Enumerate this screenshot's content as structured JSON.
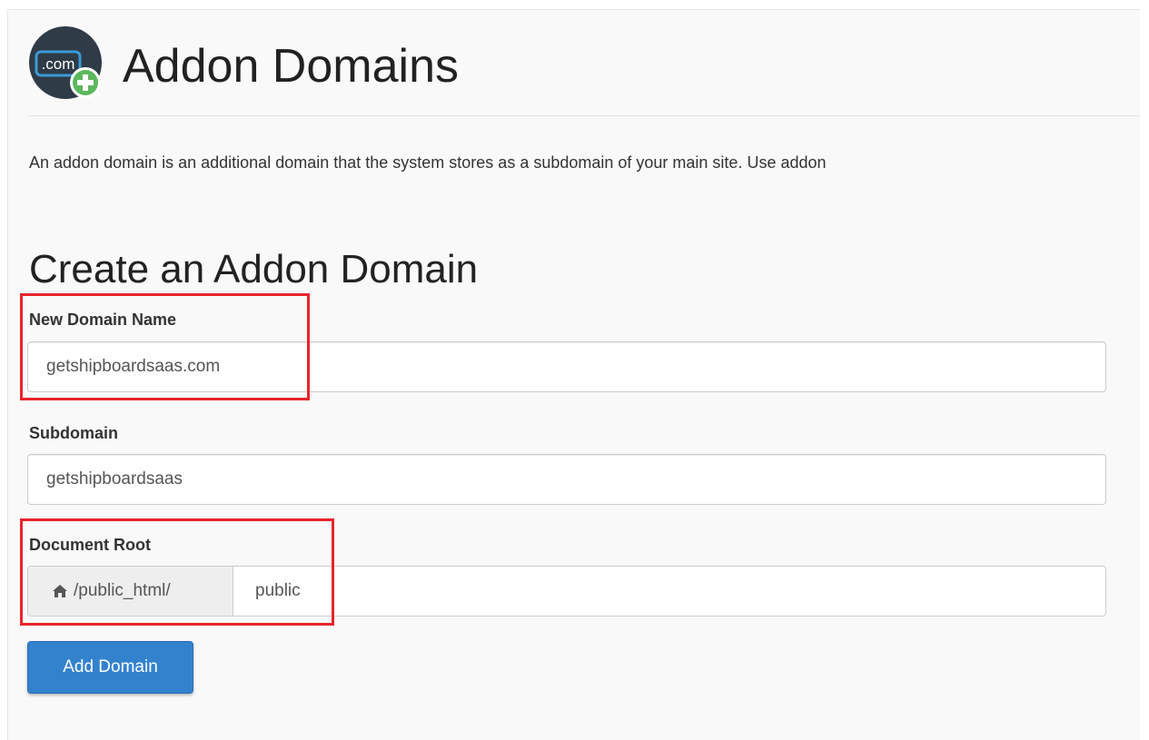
{
  "header": {
    "title": "Addon Domains",
    "icon": "com-plus-icon",
    "icon_text": ".com"
  },
  "description": "An addon domain is an additional domain that the system stores as a subdomain of your main site. Use addon",
  "form": {
    "title": "Create an Addon Domain",
    "new_domain": {
      "label": "New Domain Name",
      "value": "getshipboardsaas.com"
    },
    "subdomain": {
      "label": "Subdomain",
      "value": "getshipboardsaas"
    },
    "document_root": {
      "label": "Document Root",
      "prefix": "/public_html/",
      "prefix_icon": "home-icon",
      "value": "public"
    },
    "submit_label": "Add Domain"
  },
  "colors": {
    "accent": "#3382cd",
    "highlight": "#e8242b",
    "icon_bg": "#2f3b47",
    "plus_green": "#5cb85c"
  }
}
